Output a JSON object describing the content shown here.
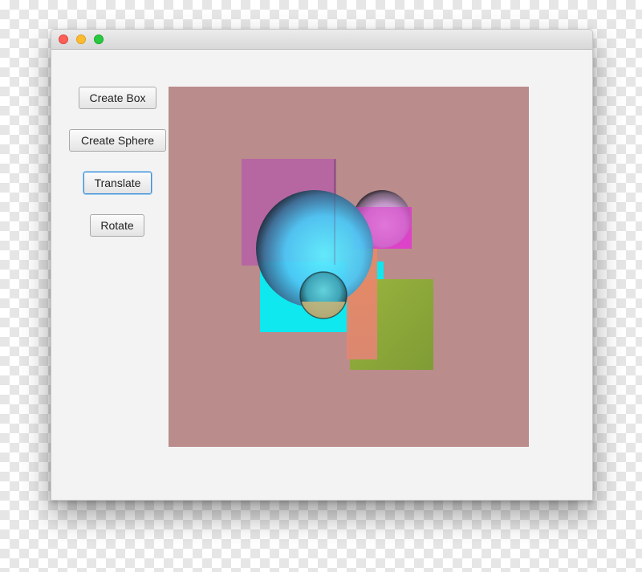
{
  "toolbar": {
    "create_box": "Create Box",
    "create_sphere": "Create Sphere",
    "translate": "Translate",
    "rotate": "Rotate"
  },
  "scene": {
    "background_color": "#ba8c8c",
    "objects": [
      {
        "shape": "box",
        "color": "#b565a3"
      },
      {
        "shape": "box",
        "color": "#0ee8ee"
      },
      {
        "shape": "box",
        "color": "#8fae3b"
      },
      {
        "shape": "box",
        "color": "#e8876a"
      },
      {
        "shape": "box",
        "color": "#de3fcb"
      },
      {
        "shape": "sphere",
        "color": "#5ad8ff"
      },
      {
        "shape": "sphere",
        "color": "#c9a8d6"
      },
      {
        "shape": "sphere",
        "color": "#4fb6c6"
      }
    ]
  }
}
